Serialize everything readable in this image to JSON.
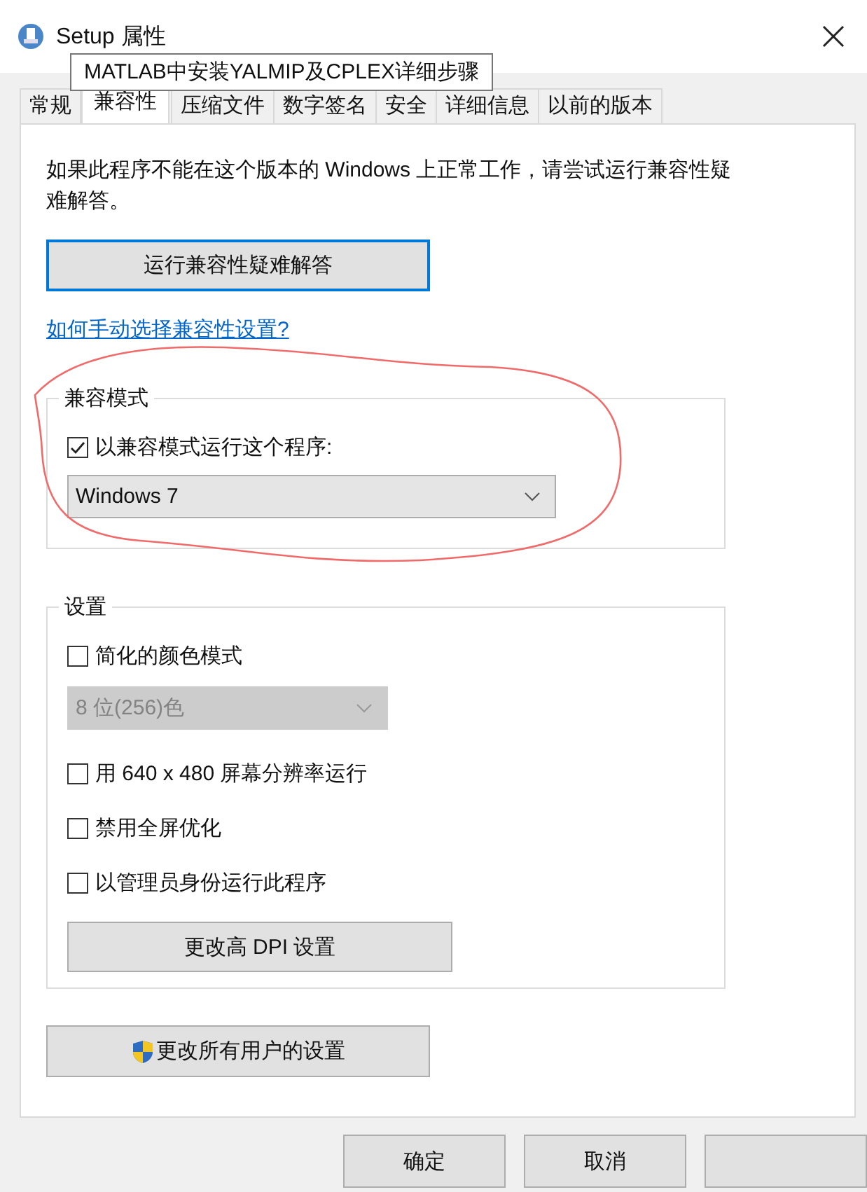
{
  "window": {
    "title": "Setup 属性"
  },
  "tooltip": "MATLAB中安装YALMIP及CPLEX详细步骤",
  "tabs": [
    {
      "label": "常规",
      "selected": false
    },
    {
      "label": "兼容性",
      "selected": true
    },
    {
      "label": "压缩文件",
      "selected": false
    },
    {
      "label": "数字签名",
      "selected": false
    },
    {
      "label": "安全",
      "selected": false
    },
    {
      "label": "详细信息",
      "selected": false
    },
    {
      "label": "以前的版本",
      "selected": false
    }
  ],
  "intro": "如果此程序不能在这个版本的 Windows 上正常工作，请尝试运行兼容性疑难解答。",
  "troubleshoot_button": "运行兼容性疑难解答",
  "help_link": "如何手动选择兼容性设置?",
  "compat_group": {
    "title": "兼容模式",
    "checkbox": {
      "label": "以兼容模式运行这个程序:",
      "checked": true
    },
    "dropdown": {
      "value": "Windows 7",
      "disabled": false
    }
  },
  "settings_group": {
    "title": "设置",
    "items": [
      {
        "kind": "checkbox",
        "label": "简化的颜色模式",
        "checked": false
      },
      {
        "kind": "dropdown",
        "value": "8 位(256)色",
        "disabled": true
      },
      {
        "kind": "checkbox",
        "label": "用 640 x 480 屏幕分辨率运行",
        "checked": false
      },
      {
        "kind": "checkbox",
        "label": "禁用全屏优化",
        "checked": false
      },
      {
        "kind": "checkbox",
        "label": "以管理员身份运行此程序",
        "checked": false
      },
      {
        "kind": "button",
        "label": "更改高 DPI 设置"
      }
    ]
  },
  "all_users_button": "更改所有用户的设置",
  "buttons": [
    "确定",
    "取消"
  ]
}
